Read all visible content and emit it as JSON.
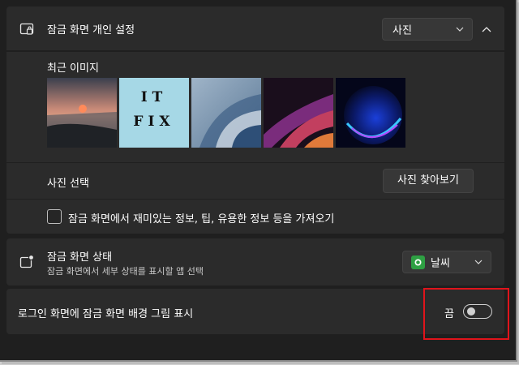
{
  "lock_screen": {
    "title": "잠금 화면 개인 설정",
    "mode_value": "사진",
    "recent_images_label": "최근 이미지",
    "recent_images": [
      {
        "name": "sunset-lake-image"
      },
      {
        "name": "itfix-logo-image",
        "text_line1": "IT",
        "text_line2": "FIX"
      },
      {
        "name": "blue-bloom-image"
      },
      {
        "name": "purple-ribbon-image"
      },
      {
        "name": "blue-orb-image"
      }
    ],
    "choose_photo_label": "사진 선택",
    "browse_button_label": "사진 찾아보기",
    "fun_facts_label": "잠금 화면에서 재미있는 정보, 팁, 유용한 정보 등을 가져오기",
    "fun_facts_checked": false
  },
  "lock_status": {
    "title": "잠금 화면 상태",
    "subtitle": "잠금 화면에서 세부 상태를 표시할 앱 선택",
    "app_value": "날씨",
    "app_icon": "weather-app-icon",
    "app_icon_color": "#2ea043"
  },
  "signin_background": {
    "label": "로그인 화면에 잠금 화면 배경 그림 표시",
    "state_label": "끔",
    "enabled": false
  },
  "highlight_color": "#e0141b"
}
